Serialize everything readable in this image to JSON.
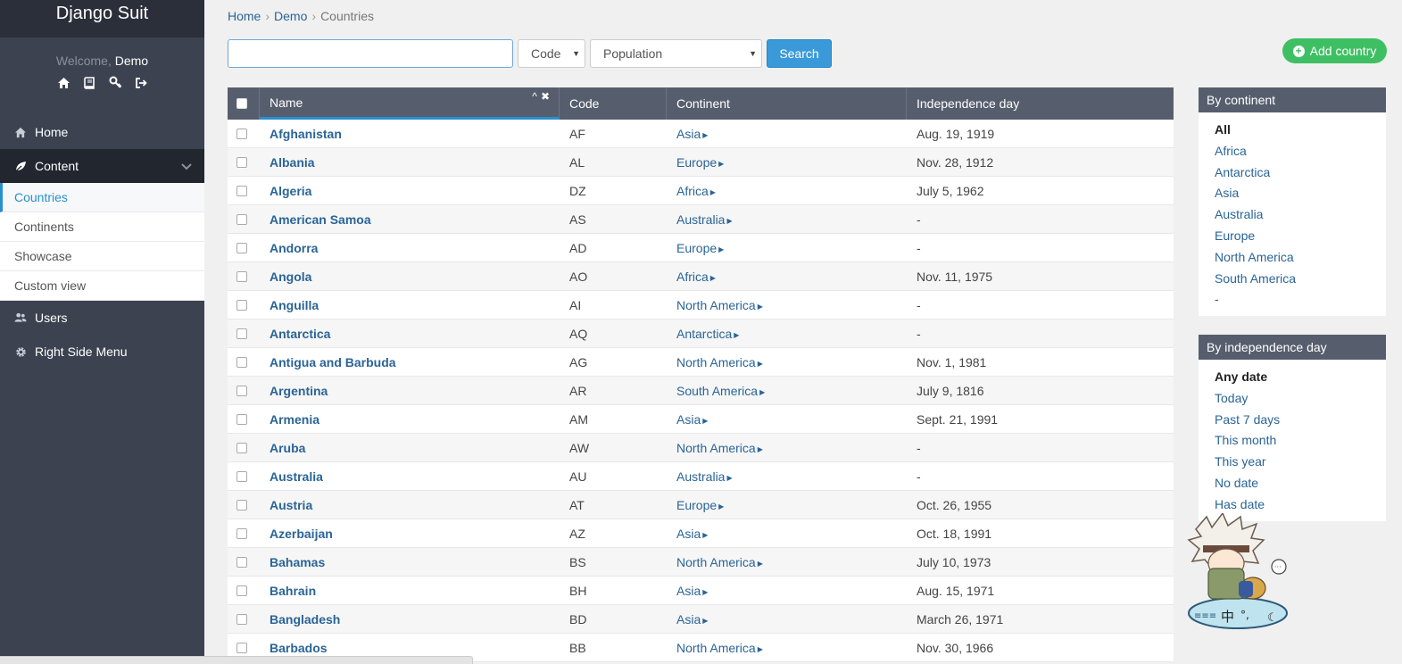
{
  "brand": "Django Suit",
  "welcome": {
    "prefix": "Welcome,",
    "user": "Demo"
  },
  "menu": {
    "home": "Home",
    "content": "Content",
    "sub": [
      "Countries",
      "Continents",
      "Showcase",
      "Custom view"
    ],
    "users": "Users",
    "right_side": "Right Side Menu"
  },
  "breadcrumb": {
    "home": "Home",
    "demo": "Demo",
    "current": "Countries"
  },
  "search": {
    "value": "",
    "code_select": "Code",
    "population_select": "Population",
    "button": "Search"
  },
  "add_button": "Add country",
  "table": {
    "headers": {
      "name": "Name",
      "code": "Code",
      "continent": "Continent",
      "independence": "Independence day"
    },
    "rows": [
      {
        "name": "Afghanistan",
        "code": "AF",
        "continent": "Asia",
        "independence": "Aug. 19, 1919"
      },
      {
        "name": "Albania",
        "code": "AL",
        "continent": "Europe",
        "independence": "Nov. 28, 1912"
      },
      {
        "name": "Algeria",
        "code": "DZ",
        "continent": "Africa",
        "independence": "July 5, 1962"
      },
      {
        "name": "American Samoa",
        "code": "AS",
        "continent": "Australia",
        "independence": "-"
      },
      {
        "name": "Andorra",
        "code": "AD",
        "continent": "Europe",
        "independence": "-"
      },
      {
        "name": "Angola",
        "code": "AO",
        "continent": "Africa",
        "independence": "Nov. 11, 1975"
      },
      {
        "name": "Anguilla",
        "code": "AI",
        "continent": "North America",
        "independence": "-"
      },
      {
        "name": "Antarctica",
        "code": "AQ",
        "continent": "Antarctica",
        "independence": "-"
      },
      {
        "name": "Antigua and Barbuda",
        "code": "AG",
        "continent": "North America",
        "independence": "Nov. 1, 1981"
      },
      {
        "name": "Argentina",
        "code": "AR",
        "continent": "South America",
        "independence": "July 9, 1816"
      },
      {
        "name": "Armenia",
        "code": "AM",
        "continent": "Asia",
        "independence": "Sept. 21, 1991"
      },
      {
        "name": "Aruba",
        "code": "AW",
        "continent": "North America",
        "independence": "-"
      },
      {
        "name": "Australia",
        "code": "AU",
        "continent": "Australia",
        "independence": "-"
      },
      {
        "name": "Austria",
        "code": "AT",
        "continent": "Europe",
        "independence": "Oct. 26, 1955"
      },
      {
        "name": "Azerbaijan",
        "code": "AZ",
        "continent": "Asia",
        "independence": "Oct. 18, 1991"
      },
      {
        "name": "Bahamas",
        "code": "BS",
        "continent": "North America",
        "independence": "July 10, 1973"
      },
      {
        "name": "Bahrain",
        "code": "BH",
        "continent": "Asia",
        "independence": "Aug. 15, 1971"
      },
      {
        "name": "Bangladesh",
        "code": "BD",
        "continent": "Asia",
        "independence": "March 26, 1971"
      },
      {
        "name": "Barbados",
        "code": "BB",
        "continent": "North America",
        "independence": "Nov. 30, 1966"
      }
    ]
  },
  "filters": {
    "continent": {
      "title": "By continent",
      "items": [
        "All",
        "Africa",
        "Antarctica",
        "Asia",
        "Australia",
        "Europe",
        "North America",
        "South America",
        "-"
      ]
    },
    "independence": {
      "title": "By independence day",
      "items": [
        "Any date",
        "Today",
        "Past 7 days",
        "This month",
        "This year",
        "No date",
        "Has date"
      ]
    }
  },
  "colors": {
    "sidebar": "#3c4250",
    "accent": "#2a8fcf",
    "add": "#3fbf63",
    "header": "#565e6e"
  },
  "icons": [
    "home-icon",
    "book-icon",
    "key-icon",
    "sign-out-icon",
    "leaf-icon",
    "users-icon",
    "gear-icon",
    "plus-circle-icon"
  ]
}
